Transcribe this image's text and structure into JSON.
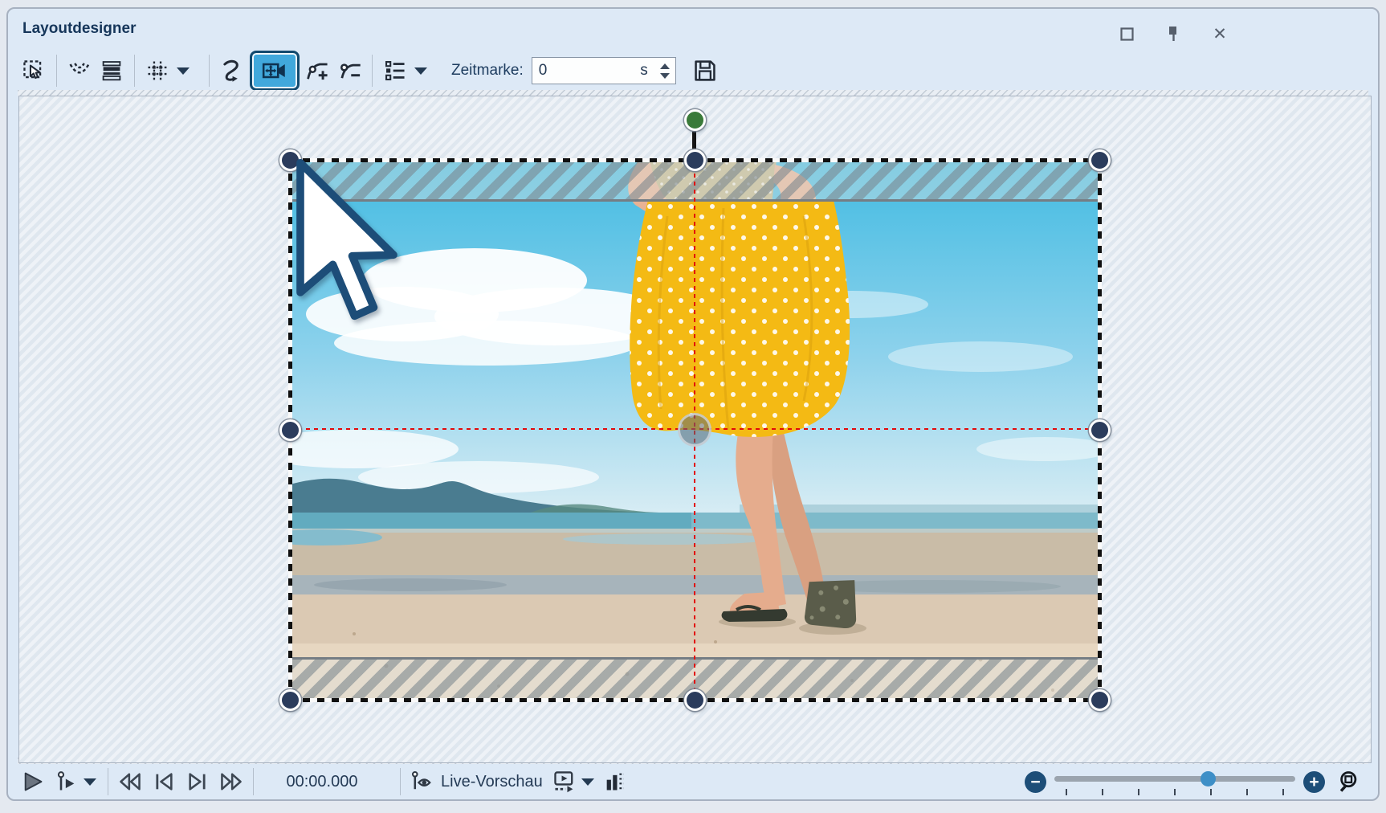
{
  "window": {
    "title": "Layoutdesigner",
    "controls": {
      "maximize": "maximize",
      "pin": "pin",
      "close_glyph": "✕"
    }
  },
  "toolbar": {
    "buttons": [
      {
        "name": "select-tool",
        "active": false
      },
      {
        "name": "motion-curves",
        "active": false
      },
      {
        "name": "layers",
        "active": false
      },
      {
        "name": "grid",
        "active": false,
        "has_menu": true
      },
      {
        "name": "curve-mode",
        "active": false
      },
      {
        "name": "camera-pan",
        "active": true
      },
      {
        "name": "add-keyframe",
        "active": false
      },
      {
        "name": "remove-keyframe",
        "active": false
      },
      {
        "name": "object-list",
        "active": false,
        "has_menu": true
      }
    ],
    "zeitmarke": {
      "label": "Zeitmarke:",
      "value": "0",
      "unit": "s"
    }
  },
  "canvas": {
    "image_alt": "Frau in gelbem Punkterock läuft barfuß mit Sandalen am Strand",
    "selection_handles": 8,
    "crosshair_color": "#e20a0a"
  },
  "transport": {
    "time": "00:00.000",
    "live_preview_label": "Live-Vorschau",
    "zoom_minus_glyph": "−",
    "zoom_plus_glyph": "+",
    "zoom_thumb_percent": 64
  },
  "colors": {
    "accent_active": "#41a8dc",
    "handle_fill": "#2b3c5c",
    "rotation_handle": "#3a7a39",
    "crosshair": "#e20a0a",
    "skirt_yellow": "#f4ba14",
    "window_bg": "#dde9f6"
  }
}
